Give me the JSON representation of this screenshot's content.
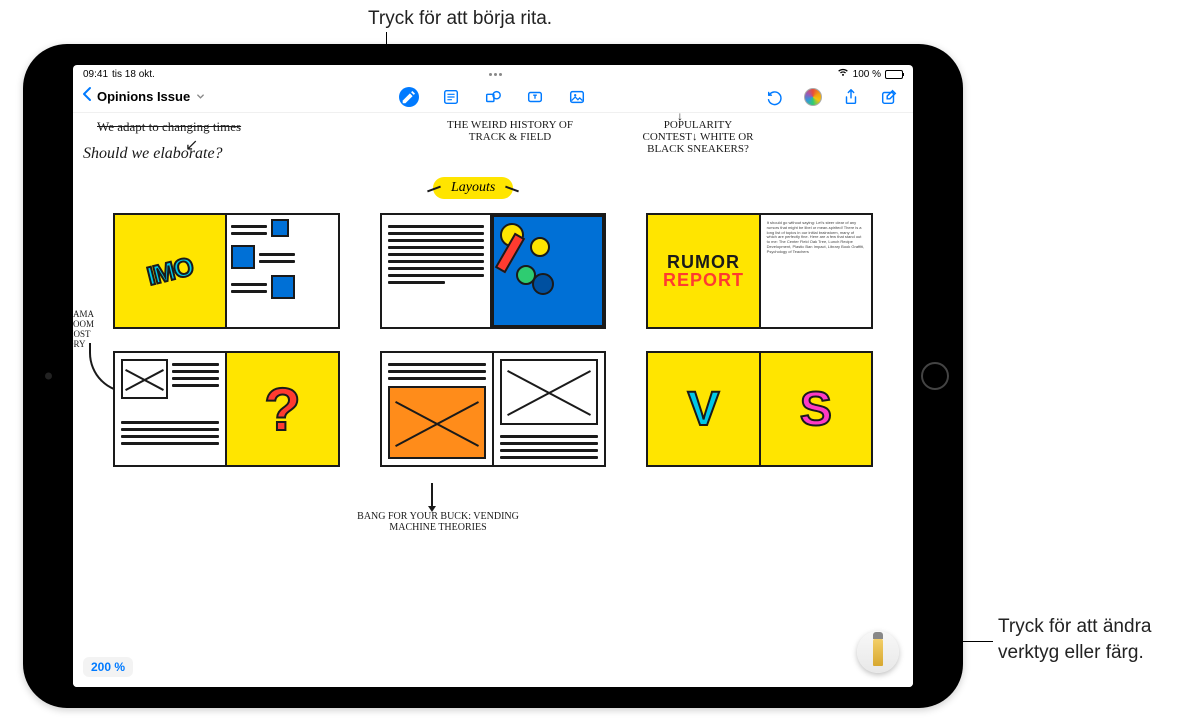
{
  "callouts": {
    "top": "Tryck för att börja rita.",
    "bottom": "Tryck för att ändra verktyg eller färg."
  },
  "status": {
    "time": "09:41",
    "date": "tis 18 okt.",
    "battery_pct": "100 %"
  },
  "nav": {
    "doc_title": "Opinions Issue"
  },
  "handwriting": {
    "crossed": "We adapt to changing times",
    "elaborate": "Should we elaborate?",
    "weird_history": "THE WEIRD HISTORY OF TRACK & FIELD",
    "popularity": "POPULARITY CONTEST↓ WHITE OR BLACK SNEAKERS?",
    "layouts": "Layouts",
    "side_note": "RAMA ROOM HOST ORY",
    "bottom_note": "BANG FOR YOUR BUCK: VENDING MACHINE THEORIES",
    "rumor_l1": "RUMOR",
    "rumor_l2": "REPORT",
    "imo": "IMO",
    "v": "V",
    "s": "S",
    "qmark": "?",
    "tiny": "It should go without saying: Let's steer clear of any rumors that might be libel or mean-spirited! There is a long list of topics in our initial brainstorm, many of which are perfectly fine. Here are a few that stand out to me: The Center Field Oak Tree, Lunch Recipe Development, Plastic Ban Impact, Library Book Graffiti, Psychology of Teachers"
  },
  "zoom": "200 %",
  "icons": {
    "back": "back-chevron-icon",
    "draw": "draw-tool-icon",
    "note": "sticky-note-icon",
    "shape": "shape-icon",
    "textbox": "textbox-icon",
    "media": "media-icon",
    "undo": "undo-icon",
    "palette": "palette-icon",
    "share": "share-icon",
    "compose": "compose-icon",
    "pen": "pen-tool-icon"
  }
}
